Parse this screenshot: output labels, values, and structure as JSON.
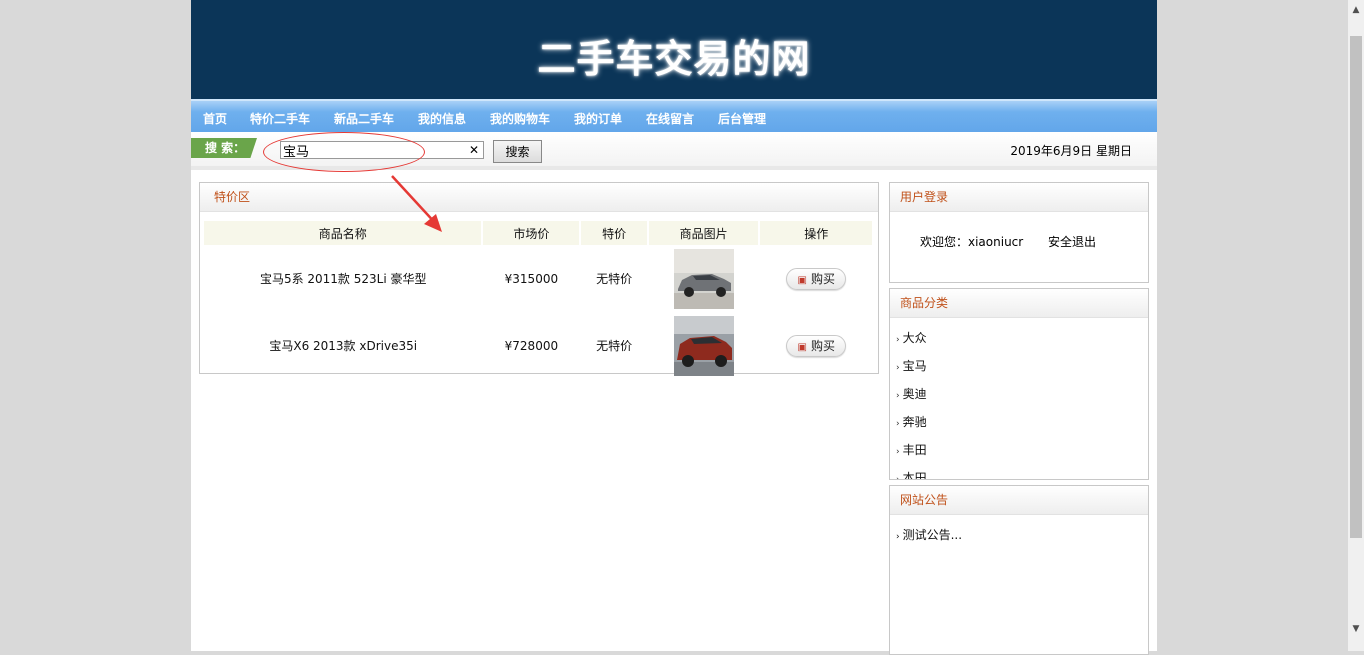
{
  "site": {
    "title": "二手车交易的网"
  },
  "nav": {
    "items": [
      {
        "label": "首页"
      },
      {
        "label": "特价二手车"
      },
      {
        "label": "新品二手车"
      },
      {
        "label": "我的信息"
      },
      {
        "label": "我的购物车"
      },
      {
        "label": "我的订单"
      },
      {
        "label": "在线留言"
      },
      {
        "label": "后台管理"
      }
    ]
  },
  "search": {
    "tag_label": "搜 索：",
    "value": "宝马",
    "clear_icon": "✕",
    "button_label": "搜索",
    "date_text": "2019年6月9日  星期日"
  },
  "deals": {
    "title": "特价区",
    "columns": [
      "商品名称",
      "市场价",
      "特价",
      "商品图片",
      "操作"
    ],
    "rows": [
      {
        "name": "宝马5系 2011款 523Li 豪华型",
        "market_price": "¥315000",
        "special_price": "无特价",
        "image": "gray-sedan",
        "action": "购买"
      },
      {
        "name": "宝马X6 2013款 xDrive35i",
        "market_price": "¥728000",
        "special_price": "无特价",
        "image": "red-suv",
        "action": "购买"
      }
    ]
  },
  "login": {
    "title": "用户登录",
    "welcome": "欢迎您：xiaoniucr",
    "logout": "安全退出"
  },
  "categories": {
    "title": "商品分类",
    "items": [
      "大众",
      "宝马",
      "奥迪",
      "奔驰",
      "丰田",
      "本田"
    ]
  },
  "notice": {
    "title": "网站公告",
    "items": [
      "测试公告..."
    ]
  },
  "colors": {
    "banner": "#0b3558",
    "nav": "#6fb0ee",
    "section_title": "#c0511a",
    "annotation": "#e53935",
    "search_tag": "#6aa54a"
  }
}
